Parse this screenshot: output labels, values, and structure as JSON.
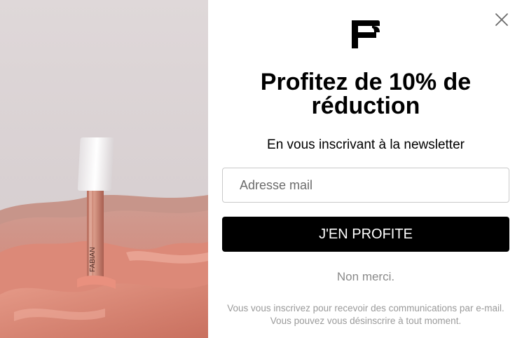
{
  "popup": {
    "headline": "Profitez de 10% de réduction",
    "subtitle": "En vous inscrivant à la newsletter",
    "email": {
      "value": "",
      "placeholder": "Adresse mail"
    },
    "cta_label": "J'EN PROFITE",
    "decline_label": "Non merci.",
    "disclaimer": "Vous vous inscrivez pour recevoir des communications par e-mail. Vous pouvez vous désinscrire à tout moment."
  },
  "brand": {
    "logo_icon": "fabian-f-logo-icon",
    "product_text": "FABIAN"
  },
  "icons": {
    "close": "close-icon"
  },
  "colors": {
    "cta_background": "#000000",
    "cta_text": "#ffffff",
    "muted_text": "#8a8a8a",
    "sand": "#d88373"
  }
}
